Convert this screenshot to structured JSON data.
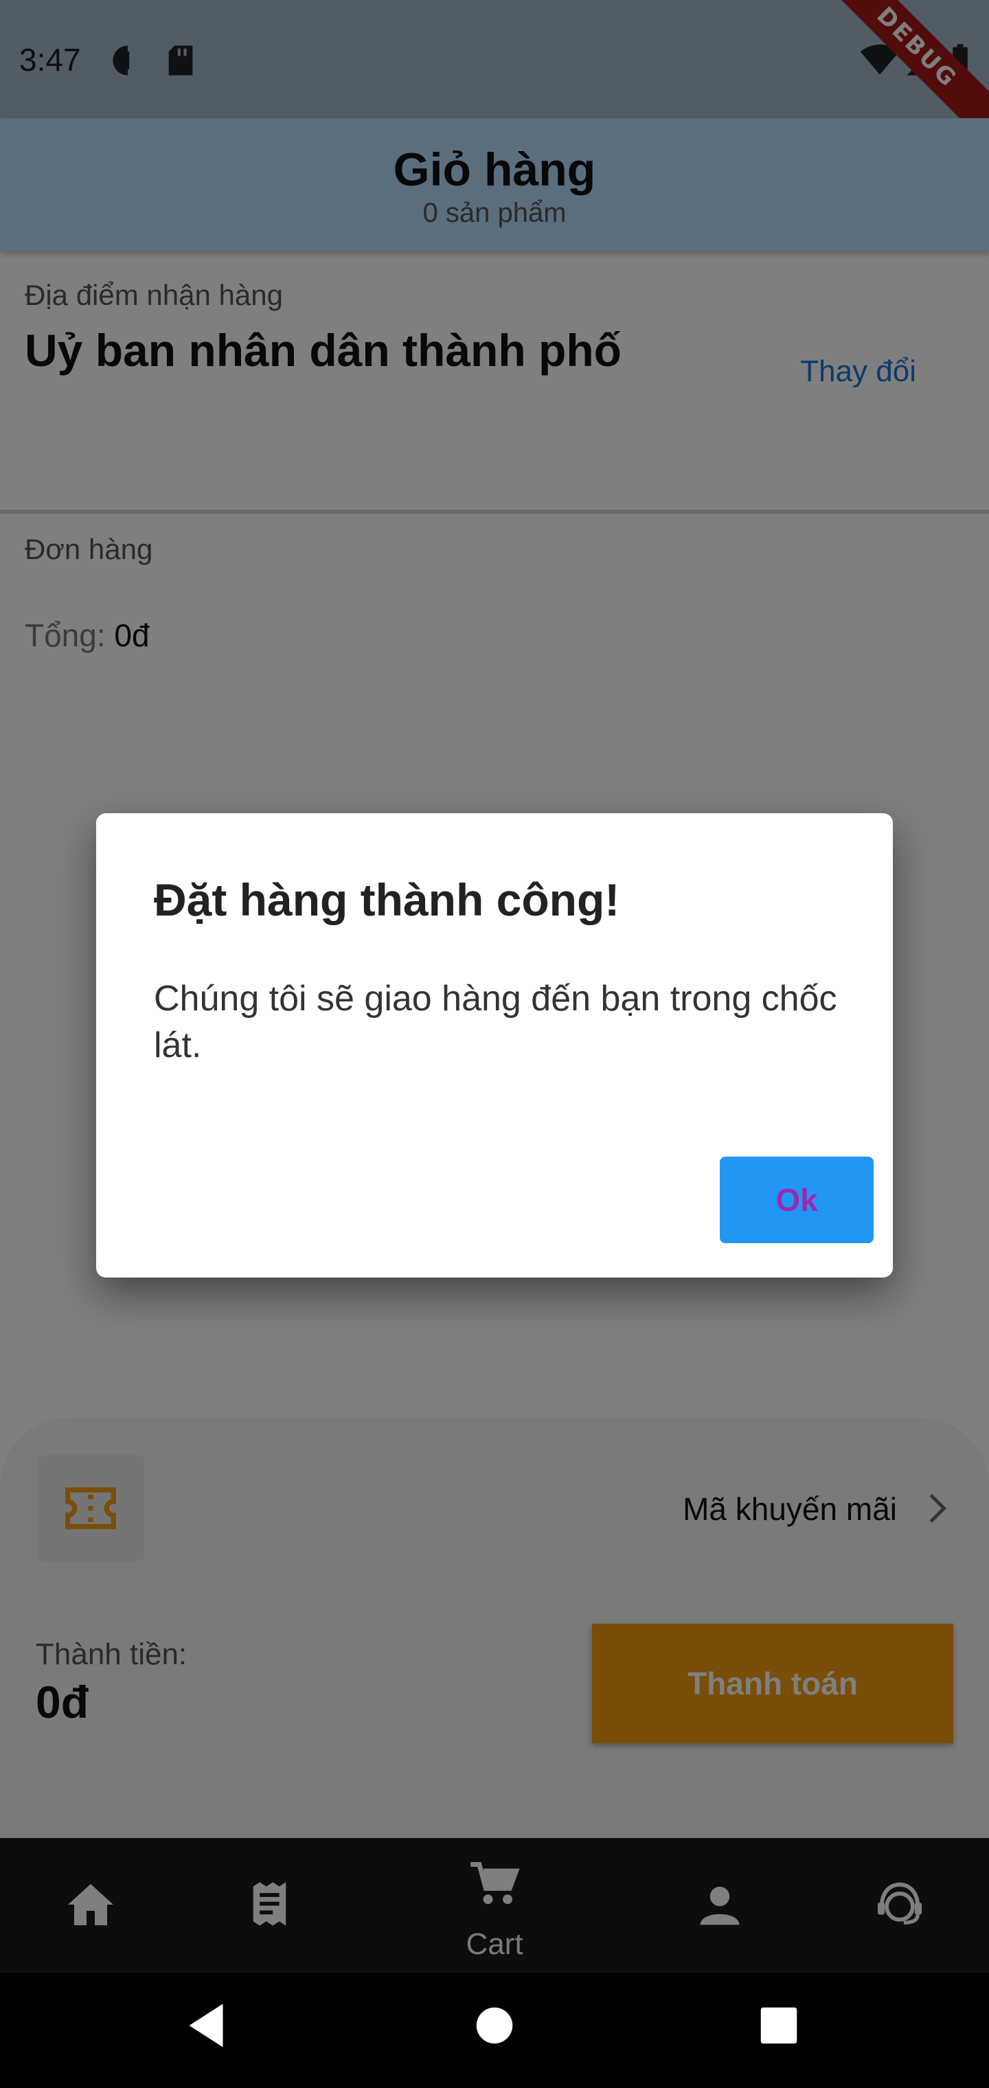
{
  "status_bar": {
    "time": "3:47",
    "debug_label": "DEBUG"
  },
  "app_bar": {
    "title": "Giỏ hàng",
    "subtitle": "0 sản phẩm"
  },
  "location": {
    "label": "Địa điểm nhận hàng",
    "name": "Uỷ ban nhân dân thành phố",
    "change_label": "Thay đổi"
  },
  "order": {
    "label": "Đơn hàng",
    "total_label": "Tổng:",
    "total_value": "0đ"
  },
  "bottom_panel": {
    "promo_icon": "ticket-icon",
    "promo_label": "Mã khuyến mãi",
    "subtotal_label": "Thành tiền:",
    "subtotal_value": "0đ",
    "pay_label": "Thanh toán"
  },
  "bottom_nav": {
    "items": [
      {
        "icon": "home-icon",
        "label": ""
      },
      {
        "icon": "receipt-icon",
        "label": ""
      },
      {
        "icon": "cart-icon",
        "label": "Cart"
      },
      {
        "icon": "person-icon",
        "label": ""
      },
      {
        "icon": "support-agent-icon",
        "label": ""
      }
    ],
    "active_index": 2
  },
  "dialog": {
    "title": "Đặt hàng thành công!",
    "message": "Chúng tôi sẽ giao hàng đến bạn trong chốc lát.",
    "ok_label": "Ok"
  },
  "colors": {
    "app_bar": "#b6ddfc",
    "accent_orange": "#f39c12",
    "link_blue": "#1976d2",
    "ok_button": "#2196f3",
    "ok_text": "#9c27b0"
  }
}
